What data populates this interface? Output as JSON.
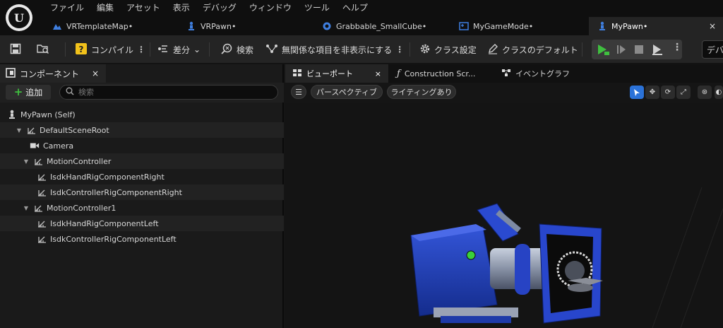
{
  "menu": [
    "ファイル",
    "編集",
    "アセット",
    "表示",
    "デバッグ",
    "ウィンドウ",
    "ツール",
    "ヘルプ"
  ],
  "doc_tabs": [
    {
      "label": "VRTemplateMap•",
      "icon": "level-icon"
    },
    {
      "label": "VRPawn•",
      "icon": "pawn-icon"
    },
    {
      "label": "Grabbable_SmallCube•",
      "icon": "blueprint-actor-icon"
    },
    {
      "label": "MyGameMode•",
      "icon": "gamemode-icon"
    },
    {
      "label": "MyPawn•",
      "icon": "pawn-icon",
      "active": true,
      "close": "×"
    }
  ],
  "toolbar": {
    "compile": "コンパイル",
    "diff": "差分",
    "search": "検索",
    "hide_unrelated": "無関係な項目を非表示にする",
    "class_settings": "クラス設定",
    "class_defaults": "クラスのデフォルト",
    "right_search": "デバ"
  },
  "components_panel": {
    "title": "コンポーネント",
    "close": "×",
    "add_label": "追加",
    "search_placeholder": "検索",
    "tree": [
      {
        "label": "MyPawn (Self)",
        "depth": 0,
        "caret": false,
        "icon": "pawn-icon"
      },
      {
        "label": "DefaultSceneRoot",
        "depth": 1,
        "caret": true,
        "icon": "scene-component-icon"
      },
      {
        "label": "Camera",
        "depth": 2,
        "caret": false,
        "icon": "camera-icon"
      },
      {
        "label": "MotionController",
        "depth": 2,
        "caret": true,
        "icon": "scene-component-icon"
      },
      {
        "label": "IsdkHandRigComponentRight",
        "depth": 3,
        "caret": false,
        "icon": "scene-component-icon"
      },
      {
        "label": "IsdkControllerRigComponentRight",
        "depth": 3,
        "caret": false,
        "icon": "scene-component-icon"
      },
      {
        "label": "MotionController1",
        "depth": 2,
        "caret": true,
        "icon": "scene-component-icon"
      },
      {
        "label": "IsdkHandRigComponentLeft",
        "depth": 3,
        "caret": false,
        "icon": "scene-component-icon"
      },
      {
        "label": "IsdkControllerRigComponentLeft",
        "depth": 3,
        "caret": false,
        "icon": "scene-component-icon"
      }
    ]
  },
  "viewport": {
    "tabs": [
      {
        "label": "ビューポート",
        "active": true,
        "close": "×",
        "icon": "viewport-icon"
      },
      {
        "label": "Construction Scr...",
        "icon": "function-icon"
      },
      {
        "label": "イベントグラフ",
        "icon": "event-graph-icon"
      }
    ],
    "perspective": "パースペクティブ",
    "lighting": "ライティングあり"
  },
  "colors": {
    "accent_blue": "#2b72d8",
    "play_green": "#3fbf3f",
    "camera_body": "#1f3fb4"
  }
}
